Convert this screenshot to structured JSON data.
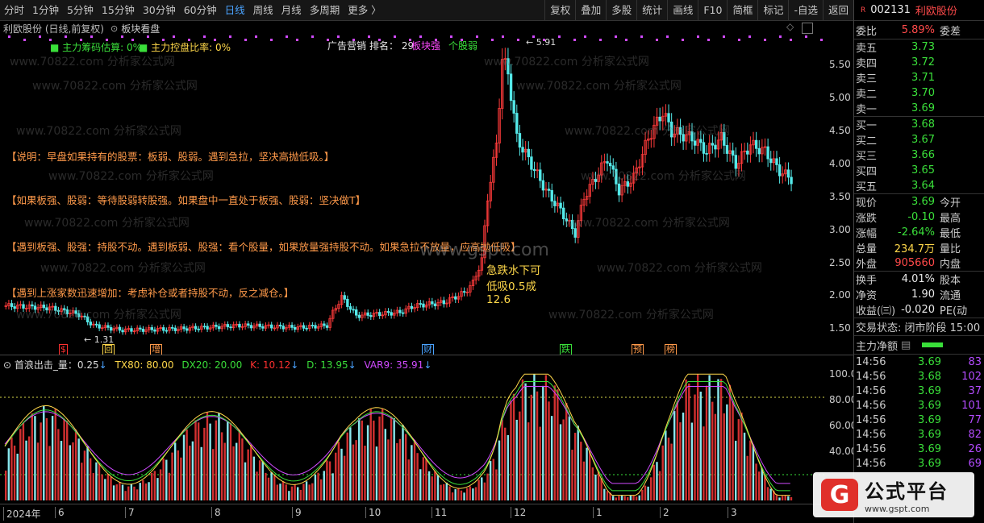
{
  "toolbar": {
    "periods": [
      "分时",
      "1分钟",
      "5分钟",
      "15分钟",
      "30分钟",
      "60分钟",
      "日线",
      "周线",
      "月线",
      "多周期",
      "更多 〉"
    ],
    "active_period": "日线",
    "right_buttons": [
      "复权",
      "叠加",
      "多股",
      "统计",
      "画线",
      "F10",
      "简框",
      "标记",
      "-自选",
      "返回"
    ]
  },
  "infobar": {
    "stock": "利欧股份 (日线,前复权)",
    "panel": "板块看盘"
  },
  "main": {
    "legend1": "主力筹码估算: 0%",
    "legend2": "主力控盘比率: 0%",
    "sector_label": "广告营销",
    "rank_label": "排名： 29",
    "sector_strength": "板块强",
    "stock_strength": "个股弱",
    "notes": [
      "【说明：早盘如果持有的股票：板弱、股弱。遇到急拉，坚决高抛低吸。】",
      "【如果板强、股弱：等待股弱转股强。如果盘中一直处于板强、股弱：坚决做T】",
      "【遇到板强、股强：持股不动。遇到板弱、股强：看个股量，如果放量强持股不动。如果急拉不放量，应高抛低吸】",
      "【遇到上涨家数迅速增加：考虑补仓或者持股不动，反之减仓。】"
    ],
    "anno1": "急跌水下可",
    "anno2": "低吸0.5成",
    "anno3": "12.6",
    "low_label": "← 1.31",
    "high_label": "← 5.91",
    "gspt": "www.gspt.com",
    "watermark": "www.70822.com 分析家公式网",
    "ytick_labels": [
      "5.50",
      "5.00",
      "4.50",
      "4.00",
      "3.50",
      "3.00",
      "2.50",
      "2.00",
      "1.50"
    ],
    "event_marks": [
      {
        "label": "$",
        "color": "#ff3030"
      },
      {
        "label": "回",
        "color": "#ffd84a"
      },
      {
        "label": "增",
        "color": "#ff9a4a"
      },
      {
        "label": "财",
        "color": "#4aa3ff"
      },
      {
        "label": "跌",
        "color": "#3adf3a"
      },
      {
        "label": "预",
        "color": "#ff9a4a"
      },
      {
        "label": "榜",
        "color": "#ff9a4a"
      }
    ]
  },
  "sub": {
    "title": "首浪出击_量：0.25",
    "tx80": "TX80: 80.00",
    "dx20": "DX20: 20.00",
    "k": "K: 10.12",
    "d": "D: 13.95",
    "var9": "VAR9: 35.91",
    "ytick_labels": [
      "100.0",
      "80.00",
      "60.00",
      "40.00"
    ]
  },
  "xaxis": {
    "labels": [
      "2024年",
      "6",
      "7",
      "8",
      "9",
      "10",
      "11",
      "12",
      "1",
      "2",
      "3"
    ]
  },
  "quote": {
    "code": "002131",
    "name": "利欧股份",
    "weibi_label": "委比",
    "weibi": "5.89%",
    "weicha_label": "委差",
    "asks": [
      {
        "label": "卖五",
        "price": "3.73"
      },
      {
        "label": "卖四",
        "price": "3.72"
      },
      {
        "label": "卖三",
        "price": "3.71"
      },
      {
        "label": "卖二",
        "price": "3.70"
      },
      {
        "label": "卖一",
        "price": "3.69"
      }
    ],
    "bids": [
      {
        "label": "买一",
        "price": "3.68"
      },
      {
        "label": "买二",
        "price": "3.67"
      },
      {
        "label": "买三",
        "price": "3.66"
      },
      {
        "label": "买四",
        "price": "3.65"
      },
      {
        "label": "买五",
        "price": "3.64"
      }
    ],
    "stats": [
      {
        "l1": "现价",
        "v": "3.69",
        "c": "green",
        "l2": "今开"
      },
      {
        "l1": "涨跌",
        "v": "-0.10",
        "c": "green",
        "l2": "最高"
      },
      {
        "l1": "涨幅",
        "v": "-2.64%",
        "c": "green",
        "l2": "最低"
      },
      {
        "l1": "总量",
        "v": "234.7万",
        "c": "yellow",
        "l2": "量比"
      },
      {
        "l1": "外盘",
        "v": "905660",
        "c": "red",
        "l2": "内盘"
      }
    ],
    "stats2": [
      {
        "l1": "换手",
        "v": "4.01%",
        "c": "white",
        "l2": "股本"
      },
      {
        "l1": "净资",
        "v": "1.90",
        "c": "white",
        "l2": "流通"
      },
      {
        "l1": "收益(㈢)",
        "v": "-0.020",
        "c": "white",
        "l2": "PE(动"
      }
    ],
    "trade_status": "交易状态: 闭市阶段 15:00",
    "net_inflow_label": "主力净额",
    "ticks": [
      {
        "t": "14:56",
        "p": "3.69",
        "v": "83"
      },
      {
        "t": "14:56",
        "p": "3.68",
        "v": "102"
      },
      {
        "t": "14:56",
        "p": "3.69",
        "v": "37"
      },
      {
        "t": "14:56",
        "p": "3.69",
        "v": "101"
      },
      {
        "t": "14:56",
        "p": "3.69",
        "v": "77"
      },
      {
        "t": "14:56",
        "p": "3.69",
        "v": "82"
      },
      {
        "t": "14:56",
        "p": "3.69",
        "v": "26"
      },
      {
        "t": "14:56",
        "p": "3.69",
        "v": "69"
      }
    ]
  },
  "logo": {
    "mark": "G",
    "title": "公式平台",
    "url": "www.gspt.com"
  }
}
